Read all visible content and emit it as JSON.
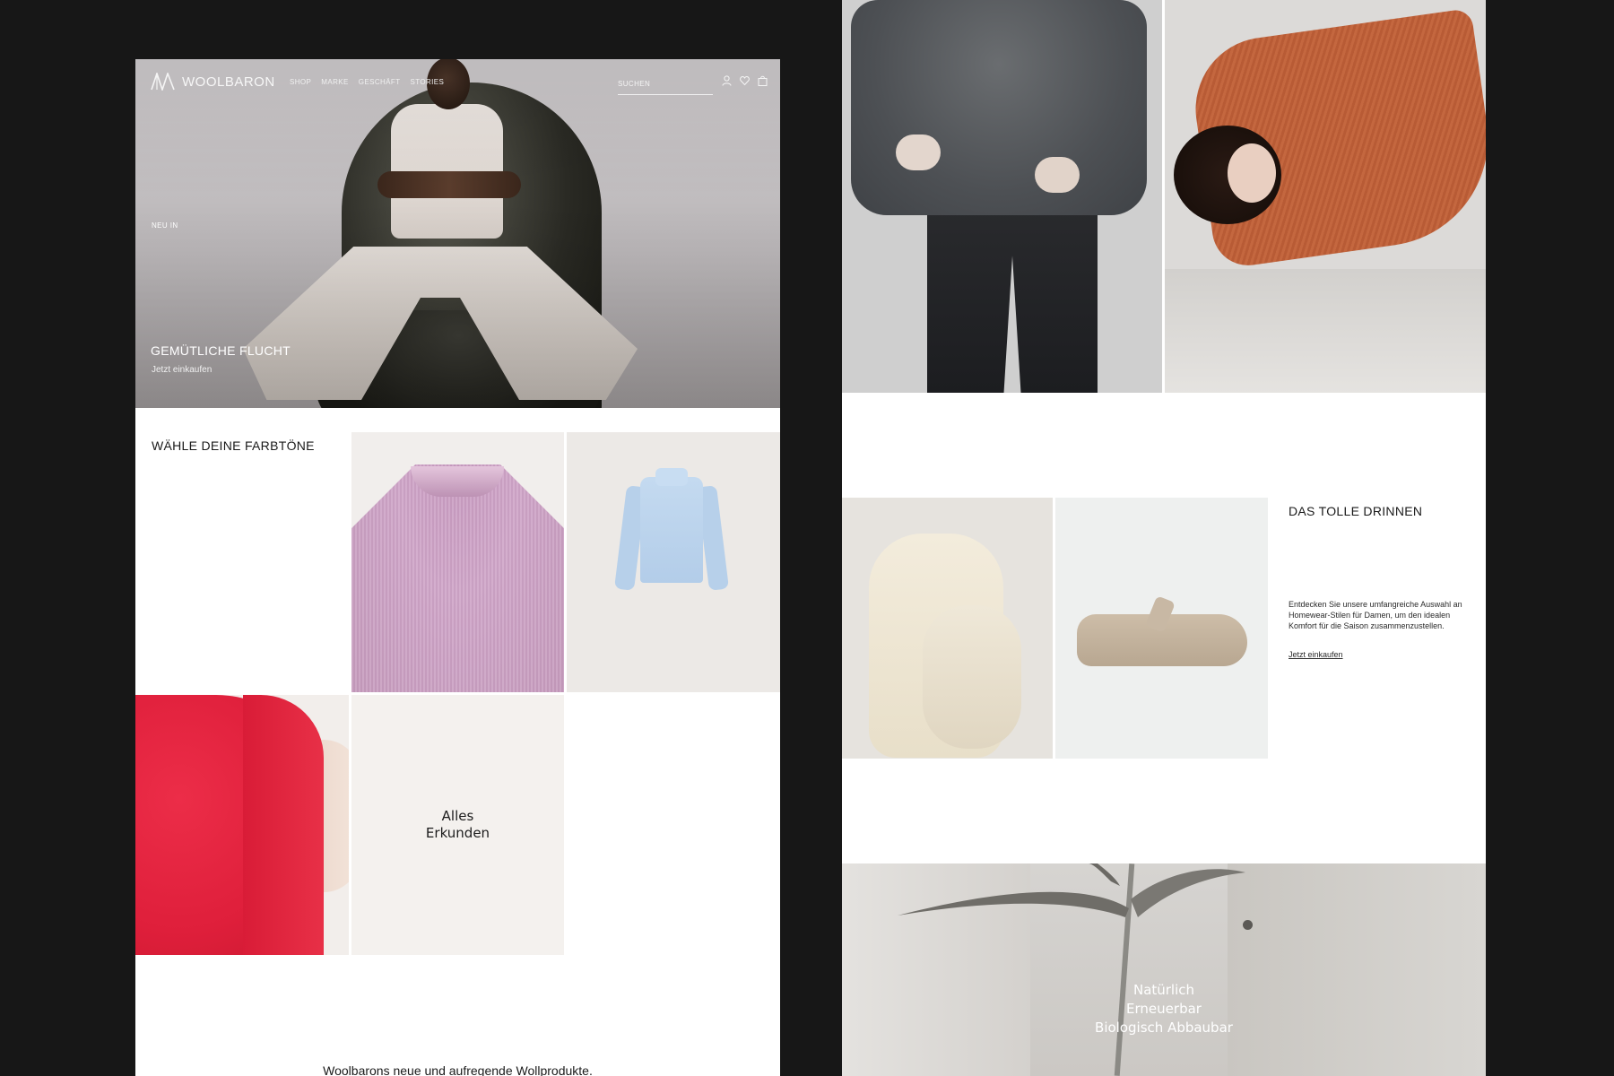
{
  "brand": {
    "name": "WOOLBARON"
  },
  "nav": {
    "links": [
      "SHOP",
      "MARKE",
      "GESCHÄFT",
      "STORIES"
    ],
    "search_placeholder": "SUCHEN",
    "icons": [
      "account-icon",
      "wishlist-icon",
      "bag-icon"
    ]
  },
  "hero": {
    "badge": "NEU IN",
    "title": "GEMÜTLICHE FLUCHT",
    "cta": "Jetzt einkaufen"
  },
  "colors_section": {
    "title": "WÄHLE DEINE FARBTÖNE",
    "explore_line1": "Alles",
    "explore_line2": "Erkunden"
  },
  "tagline": "Woolbarons neue und aufregende Wollprodukte.",
  "indoors": {
    "title": "DAS TOLLE DRINNEN",
    "description": "Entdecken Sie unsere umfangreiche Auswahl an Homewear-Stilen für Damen, um den idealen Komfort für die Saison zusammenzustellen.",
    "cta": "Jetzt einkaufen"
  },
  "values": {
    "line1": "Natürlich",
    "line2": "Erneuerbar",
    "line3": "Biologisch Abbaubar"
  },
  "palette": {
    "background": "#171717",
    "page": "#ffffff",
    "text": "#1a1a1a"
  }
}
